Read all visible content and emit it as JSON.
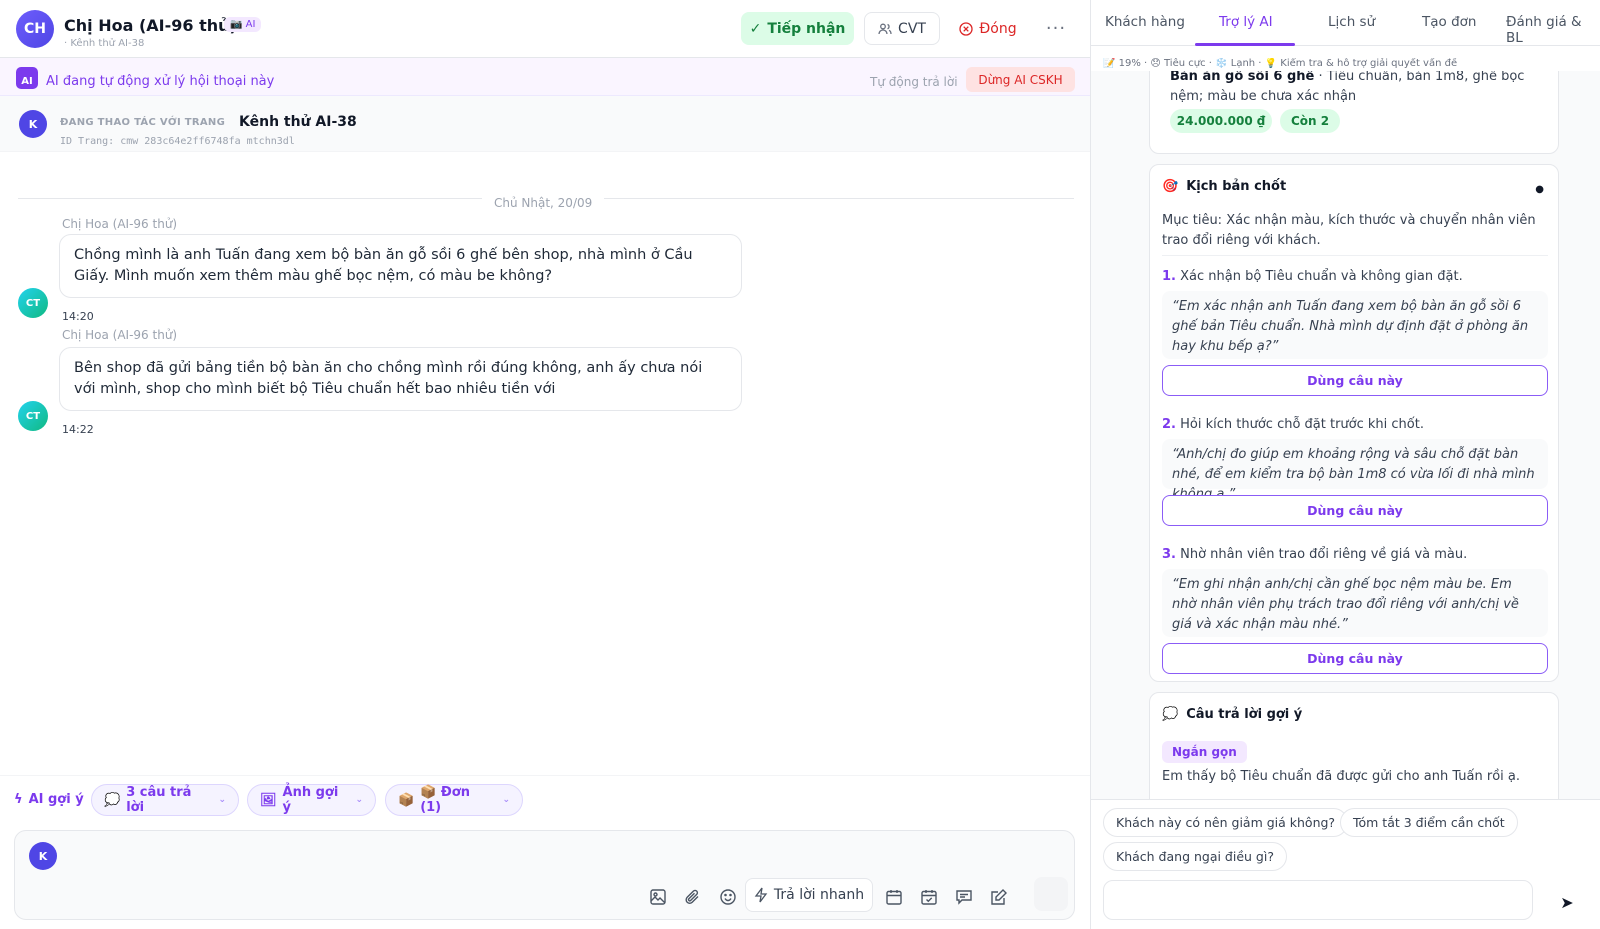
{
  "header": {
    "avatar_initials": "CH",
    "name": "Chị Hoa (AI-96 thử)",
    "badge": "📷 AI",
    "subtitle": "· Kênh thử AI-38",
    "accept_label": "Tiếp nhận",
    "cvt_label": "CVT",
    "close_label": "Đóng",
    "more_label": "···"
  },
  "ai_banner": {
    "icon_text": "AI",
    "text": "AI đang tự động xử lý hội thoại này",
    "auto_reply_label": "Tự động trả lời",
    "stop_label": "Dừng AI CSKH"
  },
  "page_bar": {
    "avatar_initials": "K",
    "label": "ĐANG THAO TÁC VỚI TRANG",
    "page_name": "Kênh thử AI-38",
    "page_id": "ID Trang: cmw_283c64e2ff6748fa_mtchn3dl"
  },
  "chat": {
    "date": "Chủ Nhật, 20/09",
    "messages": [
      {
        "sender": "Chị Hoa (AI-96 thử)",
        "avatar": "CT",
        "text": "Chồng mình là anh Tuấn đang xem bộ bàn ăn gỗ sồi 6 ghế bên shop, nhà mình ở Cầu Giấy. Mình muốn xem thêm màu ghế bọc nệm, có màu be không?",
        "time": "14:20"
      },
      {
        "sender": "Chị Hoa (AI-96 thử)",
        "avatar": "CT",
        "text": "Bên shop đã gửi bảng tiền bộ bàn ăn cho chồng mình rồi đúng không, anh ấy chưa nói với mình, shop cho mình biết bộ Tiêu chuẩn hết bao nhiêu tiền với",
        "time": "14:22"
      }
    ]
  },
  "suggestions": {
    "lead": "AI gợi ý",
    "chips": [
      {
        "icon": "💭",
        "label": "3 câu trả lời"
      },
      {
        "icon": "🖼",
        "label": "Ảnh gợi ý"
      },
      {
        "icon": "📦",
        "label": "📦 Đơn (1)"
      }
    ]
  },
  "composer": {
    "avatar_initials": "K",
    "quick_reply_label": "Trả lời nhanh"
  },
  "right_tabs": [
    "Khách hàng",
    "Trợ lý AI",
    "Lịch sử",
    "Tạo đơn",
    "Đánh giá & BL"
  ],
  "right_active_tab": "Trợ lý AI",
  "tagline": "📝 19% · 😞 Tiêu cực · ❄️ Lạnh · 💡 Kiểm tra & hỗ trợ giải quyết vấn đề",
  "product": {
    "name": "Bàn ăn gỗ sồi 6 ghế",
    "desc": " · Tiêu chuẩn, bàn 1m8, ghế bọc nệm; màu be chưa xác nhận",
    "price": "24.000.000 ₫",
    "stock": "Còn 2"
  },
  "script": {
    "title": "Kịch bản chốt",
    "goal": "Mục tiêu: Xác nhận màu, kích thước và chuyển nhân viên trao đổi riêng với khách.",
    "use_label": "Dùng câu này",
    "steps": [
      {
        "num": "1.",
        "title": "Xác nhận bộ Tiêu chuẩn và không gian đặt.",
        "quote": "“Em xác nhận anh Tuấn đang xem bộ bàn ăn gỗ sồi 6 ghế bản Tiêu chuẩn. Nhà mình dự định đặt ở phòng ăn hay khu bếp ạ?”"
      },
      {
        "num": "2.",
        "title": "Hỏi kích thước chỗ đặt trước khi chốt.",
        "quote": "“Anh/chị đo giúp em khoảng rộng và sâu chỗ đặt bàn nhé, để em kiểm tra bộ bàn 1m8 có vừa lối đi nhà mình không ạ.”"
      },
      {
        "num": "3.",
        "title": "Nhờ nhân viên trao đổi riêng về giá và màu.",
        "quote": "“Em ghi nhận anh/chị cần ghế bọc nệm màu be. Em nhờ nhân viên phụ trách trao đổi riêng với anh/chị về giá và xác nhận màu nhé.”"
      }
    ]
  },
  "suggested_answers": {
    "title": "Câu trả lời gợi ý",
    "tag": "Ngắn gọn",
    "text": "Em thấy bộ Tiêu chuẩn đã được gửi cho anh Tuấn rồi ạ."
  },
  "quick_questions": [
    "Khách này có nên giảm giá không?",
    "Tóm tắt 3 điểm cần chốt",
    "Khách đang ngại điều gì?"
  ],
  "colors": {
    "accent": "#7c3aed",
    "success": "#15803d",
    "danger": "#dc2626"
  }
}
